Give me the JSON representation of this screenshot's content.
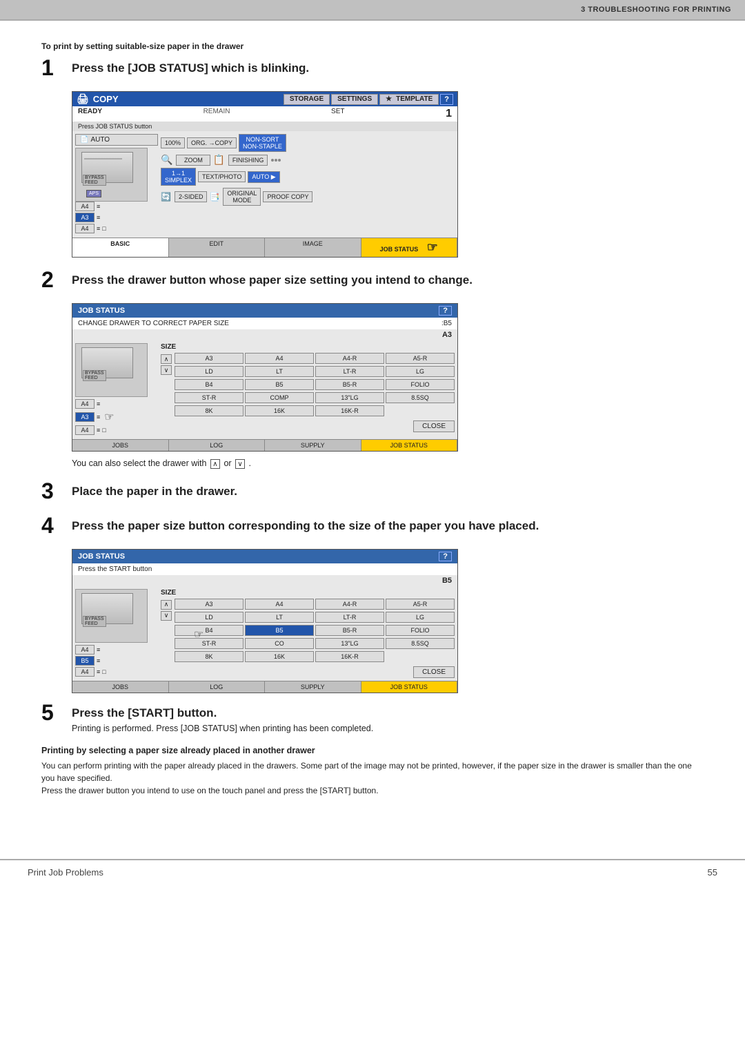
{
  "topbar": {
    "label": "3  TROUBLESHOOTING FOR PRINTING"
  },
  "subtitle": "To print by setting suitable-size paper in the drawer",
  "steps": [
    {
      "number": "1",
      "text": "Press the [JOB STATUS] which is blinking."
    },
    {
      "number": "2",
      "text": "Press the drawer button whose paper size setting you intend to change."
    },
    {
      "number": "3",
      "text": "Place the paper in the drawer."
    },
    {
      "number": "4",
      "text": "Press the paper size button corresponding to the size of the paper you have placed."
    },
    {
      "number": "5",
      "text": "Press the [START] button."
    }
  ],
  "copy_screen": {
    "title": "COPY",
    "tabs": [
      "STORAGE",
      "SETTINGS",
      "TEMPLATE"
    ],
    "help_btn": "?",
    "status": "READY",
    "status_msg": "Press JOB STATUS button",
    "right_label": "REMAIN",
    "set_label": "SET",
    "num": "1",
    "auto_label": "AUTO",
    "row1": [
      "100%",
      "ORG. → COPY",
      "NON-SORT",
      "NON-STAPLE"
    ],
    "row2": [
      "ZOOM",
      "FINISHING"
    ],
    "row3": [
      "1→1",
      "SIMPLEX",
      "TEXT/PHOTO",
      "AUTO"
    ],
    "row4": [
      "2-SIDED",
      "ORIGINAL MODE",
      "PROOF COPY"
    ],
    "drawers": [
      "A4",
      "A3",
      "A4"
    ],
    "aps_label": "APS",
    "tabs_bottom": [
      "BASIC",
      "EDIT",
      "IMAGE",
      "JOB STATUS"
    ]
  },
  "job_status_screen1": {
    "title": "JOB STATUS",
    "help_btn": "?",
    "msg": "CHANGE DRAWER TO CORRECT PAPER SIZE",
    "paper_hint": ":B5",
    "paper_current": "A3",
    "size_label": "SIZE",
    "sizes_row1": [
      "A3",
      "A4",
      "A4-R",
      "A5-R"
    ],
    "sizes_row2": [
      "LD",
      "LT",
      "LT-R",
      "LG"
    ],
    "sizes_row3": [
      "B4",
      "B5",
      "B5-R",
      "FOLIO"
    ],
    "sizes_row4": [
      "ST-R",
      "COMP",
      "13\"LG",
      "8.5SQ"
    ],
    "sizes_row5": [
      "8K",
      "16K",
      "16K-R"
    ],
    "close_label": "CLOSE",
    "tabs_bottom": [
      "JOBS",
      "LOG",
      "SUPPLY",
      "JOB STATUS"
    ],
    "drawers": [
      "A4",
      "A3",
      "A4"
    ]
  },
  "note1": "You can also select the drawer with",
  "note1_up": "∧",
  "note1_down": "∨",
  "note1_end": "or",
  "job_status_screen2": {
    "title": "JOB STATUS",
    "help_btn": "?",
    "msg": "Press the START button",
    "paper_hint": "B5",
    "size_label": "SIZE",
    "sizes_row1": [
      "A3",
      "A4",
      "A4-R",
      "A5-R"
    ],
    "sizes_row2": [
      "LD",
      "LT",
      "LT-R",
      "LG"
    ],
    "sizes_row3": [
      "B4",
      "B5",
      "B5-R",
      "FOLIO"
    ],
    "sizes_row4": [
      "ST-R",
      "CO",
      "13\"LG",
      "8.5SQ"
    ],
    "sizes_row5": [
      "8K",
      "16K",
      "16K-R"
    ],
    "close_label": "CLOSE",
    "tabs_bottom": [
      "JOBS",
      "LOG",
      "SUPPLY",
      "JOB STATUS"
    ],
    "drawers": [
      "A4",
      "B5",
      "A4"
    ]
  },
  "step5_desc": "Printing is performed. Press [JOB STATUS] when printing has been completed.",
  "printing_note_title": "Printing by selecting a paper size already placed in another drawer",
  "printing_note_body": "You can perform printing with the paper already placed in the drawers. Some part of the image may not be printed, however, if the paper size in the drawer is smaller than the one you have specified.\nPress the drawer button you intend to use on the touch panel and press the [START] button.",
  "bottom": {
    "left": "Print Job Problems",
    "right": "55"
  },
  "sidebar_number": "3"
}
